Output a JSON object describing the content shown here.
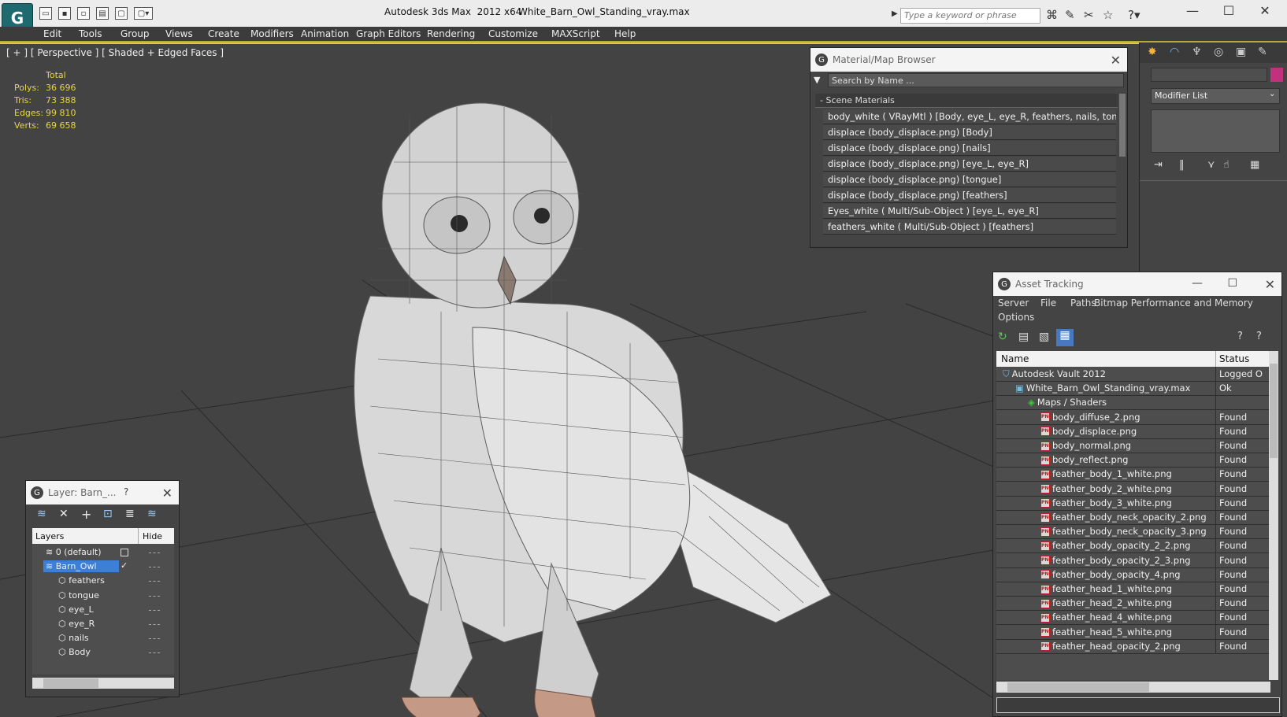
{
  "app": {
    "title": "Autodesk 3ds Max  2012 x64",
    "document": "White_Barn_Owl_Standing_vray.max",
    "search_placeholder": "Type a keyword or phrase"
  },
  "menu": [
    "Edit",
    "Tools",
    "Group",
    "Views",
    "Create",
    "Modifiers",
    "Animation",
    "Graph Editors",
    "Rendering",
    "Customize",
    "MAXScript",
    "Help"
  ],
  "viewport": {
    "label": "[ + ] [ Perspective ] [ Shaded + Edged Faces ]",
    "stats": {
      "header": "Total",
      "rows": [
        {
          "label": "Polys:",
          "value": "36 696"
        },
        {
          "label": "Tris:",
          "value": "73 388"
        },
        {
          "label": "Edges:",
          "value": "99 810"
        },
        {
          "label": "Verts:",
          "value": "69 658"
        }
      ]
    }
  },
  "material_browser": {
    "title": "Material/Map Browser",
    "search_placeholder": "Search by Name ...",
    "section": "- Scene Materials",
    "rows": [
      "body_white  ( VRayMtl )  [Body, eye_L, eye_R, feathers, nails, tongue]",
      "displace (body_displace.png) [Body]",
      "displace (body_displace.png) [nails]",
      "displace (body_displace.png) [eye_L, eye_R]",
      "displace (body_displace.png) [tongue]",
      "displace (body_displace.png) [feathers]",
      "Eyes_white  ( Multi/Sub-Object )  [eye_L, eye_R]",
      "feathers_white  ( Multi/Sub-Object )  [feathers]"
    ]
  },
  "command_panel": {
    "modifier_list": "Modifier List",
    "swatch_color": "#c0327e"
  },
  "asset_tracking": {
    "title": "Asset Tracking",
    "menu": [
      "Server",
      "File",
      "Paths",
      "Bitmap Performance and Memory",
      "Options"
    ],
    "columns": [
      "Name",
      "Status"
    ],
    "rows": [
      {
        "name": "Autodesk Vault 2012",
        "status": "Logged O",
        "indent": 0,
        "icon": "vault"
      },
      {
        "name": "White_Barn_Owl_Standing_vray.max",
        "status": "Ok",
        "indent": 1,
        "icon": "max"
      },
      {
        "name": "Maps / Shaders",
        "status": "",
        "indent": 2,
        "icon": "maps"
      },
      {
        "name": "body_diffuse_2.png",
        "status": "Found",
        "indent": 3,
        "icon": "png"
      },
      {
        "name": "body_displace.png",
        "status": "Found",
        "indent": 3,
        "icon": "png"
      },
      {
        "name": "body_normal.png",
        "status": "Found",
        "indent": 3,
        "icon": "png"
      },
      {
        "name": "body_reflect.png",
        "status": "Found",
        "indent": 3,
        "icon": "png"
      },
      {
        "name": "feather_body_1_white.png",
        "status": "Found",
        "indent": 3,
        "icon": "png"
      },
      {
        "name": "feather_body_2_white.png",
        "status": "Found",
        "indent": 3,
        "icon": "png"
      },
      {
        "name": "feather_body_3_white.png",
        "status": "Found",
        "indent": 3,
        "icon": "png"
      },
      {
        "name": "feather_body_neck_opacity_2.png",
        "status": "Found",
        "indent": 3,
        "icon": "png"
      },
      {
        "name": "feather_body_neck_opacity_3.png",
        "status": "Found",
        "indent": 3,
        "icon": "png"
      },
      {
        "name": "feather_body_opacity_2_2.png",
        "status": "Found",
        "indent": 3,
        "icon": "png"
      },
      {
        "name": "feather_body_opacity_2_3.png",
        "status": "Found",
        "indent": 3,
        "icon": "png"
      },
      {
        "name": "feather_body_opacity_4.png",
        "status": "Found",
        "indent": 3,
        "icon": "png"
      },
      {
        "name": "feather_head_1_white.png",
        "status": "Found",
        "indent": 3,
        "icon": "png"
      },
      {
        "name": "feather_head_2_white.png",
        "status": "Found",
        "indent": 3,
        "icon": "png"
      },
      {
        "name": "feather_head_4_white.png",
        "status": "Found",
        "indent": 3,
        "icon": "png"
      },
      {
        "name": "feather_head_5_white.png",
        "status": "Found",
        "indent": 3,
        "icon": "png"
      },
      {
        "name": "feather_head_opacity_2.png",
        "status": "Found",
        "indent": 3,
        "icon": "png"
      }
    ]
  },
  "layer_window": {
    "title": "Layer: Barn_...",
    "help": "?",
    "columns": [
      "Layers",
      "Hide"
    ],
    "rows": [
      {
        "name": "0 (default)",
        "indent": 1,
        "selected": false,
        "icon": "layer"
      },
      {
        "name": "Barn_Owl",
        "indent": 1,
        "selected": true,
        "icon": "layer"
      },
      {
        "name": "feathers",
        "indent": 2,
        "selected": false,
        "icon": "object"
      },
      {
        "name": "tongue",
        "indent": 2,
        "selected": false,
        "icon": "object"
      },
      {
        "name": "eye_L",
        "indent": 2,
        "selected": false,
        "icon": "object"
      },
      {
        "name": "eye_R",
        "indent": 2,
        "selected": false,
        "icon": "object"
      },
      {
        "name": "nails",
        "indent": 2,
        "selected": false,
        "icon": "object"
      },
      {
        "name": "Body",
        "indent": 2,
        "selected": false,
        "icon": "object"
      }
    ]
  }
}
